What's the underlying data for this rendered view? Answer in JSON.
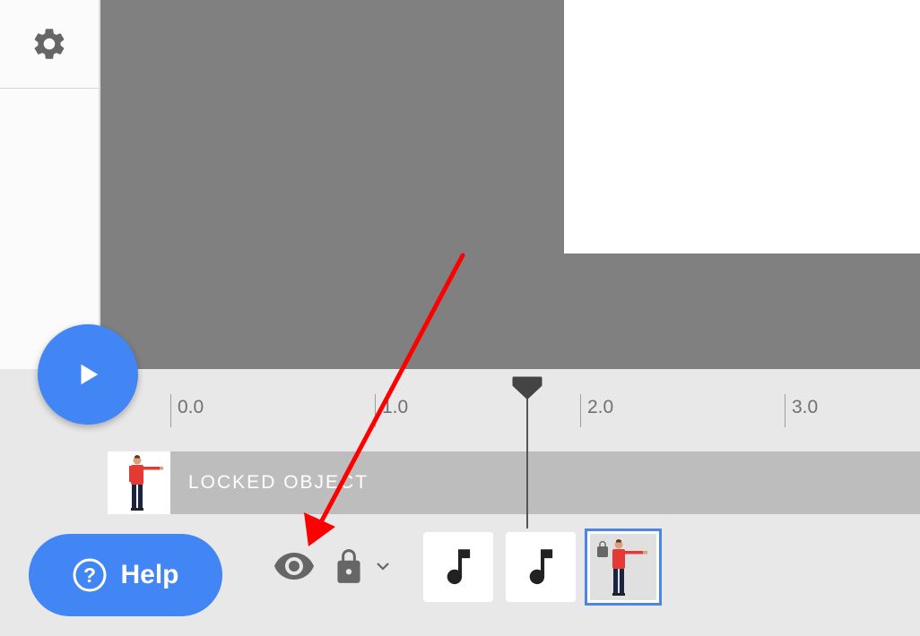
{
  "sidebar": {
    "settings_icon": "gear-icon"
  },
  "stage": {
    "background_color": "#808080",
    "canvas_color": "#ffffff"
  },
  "timeline": {
    "ticks": [
      "0.0",
      "1.0",
      "2.0",
      "3.0"
    ],
    "playhead_time": 1.75,
    "track": {
      "label": "LOCKED OBJECT"
    }
  },
  "play_button": {
    "icon": "play-icon",
    "color": "#4285f4"
  },
  "help_button": {
    "label": "Help",
    "icon": "question-circle-icon"
  },
  "controls": {
    "visibility_icon": "eye-icon",
    "lock_icon": "lock-icon",
    "dropdown_icon": "chevron-down-icon"
  },
  "assets": [
    {
      "type": "audio",
      "icon": "music-note-icon"
    },
    {
      "type": "audio",
      "icon": "music-note-icon"
    },
    {
      "type": "character",
      "icon": "person-icon",
      "locked": true,
      "selected": true
    }
  ],
  "annotation": {
    "arrow_color": "#ff0000"
  }
}
